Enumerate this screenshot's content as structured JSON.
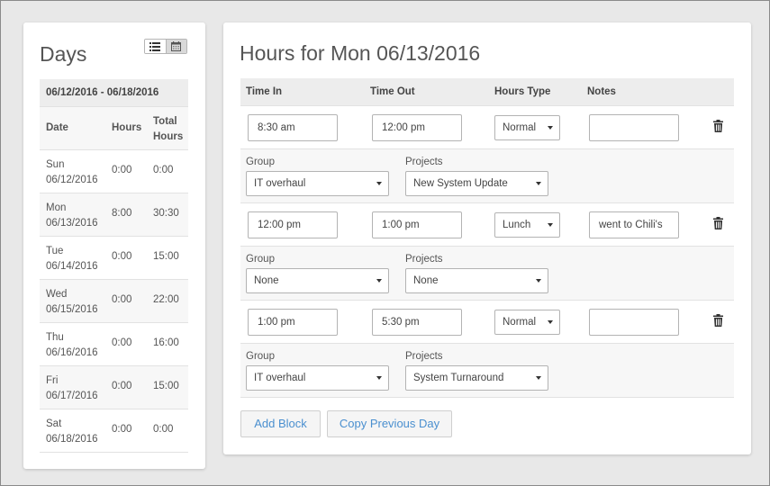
{
  "days_panel": {
    "title": "Days",
    "week_range": "06/12/2016 - 06/18/2016",
    "columns": {
      "date": "Date",
      "hours": "Hours",
      "total_line1": "Total",
      "total_line2": "Hours"
    },
    "days": [
      {
        "dow": "Sun",
        "date": "06/12/2016",
        "hours": "0:00",
        "total": "0:00"
      },
      {
        "dow": "Mon",
        "date": "06/13/2016",
        "hours": "8:00",
        "total": "30:30"
      },
      {
        "dow": "Tue",
        "date": "06/14/2016",
        "hours": "0:00",
        "total": "15:00"
      },
      {
        "dow": "Wed",
        "date": "06/15/2016",
        "hours": "0:00",
        "total": "22:00"
      },
      {
        "dow": "Thu",
        "date": "06/16/2016",
        "hours": "0:00",
        "total": "16:00"
      },
      {
        "dow": "Fri",
        "date": "06/17/2016",
        "hours": "0:00",
        "total": "15:00"
      },
      {
        "dow": "Sat",
        "date": "06/18/2016",
        "hours": "0:00",
        "total": "0:00"
      }
    ],
    "view_toggle": {
      "list_icon": "list-icon",
      "calendar_icon": "calendar-icon"
    }
  },
  "hours_panel": {
    "title": "Hours for Mon 06/13/2016",
    "columns": {
      "time_in": "Time In",
      "time_out": "Time Out",
      "hours_type": "Hours Type",
      "notes": "Notes"
    },
    "group_label": "Group",
    "projects_label": "Projects",
    "blocks": [
      {
        "time_in": "8:30 am",
        "time_out": "12:00 pm",
        "hours_type": "Normal",
        "notes": "",
        "group": "IT overhaul",
        "project": "New System Update"
      },
      {
        "time_in": "12:00 pm",
        "time_out": "1:00 pm",
        "hours_type": "Lunch",
        "notes": "went to Chili's",
        "group": "None",
        "project": "None"
      },
      {
        "time_in": "1:00 pm",
        "time_out": "5:30 pm",
        "hours_type": "Normal",
        "notes": "",
        "group": "IT overhaul",
        "project": "System Turnaround"
      }
    ],
    "buttons": {
      "add_block": "Add Block",
      "copy_previous_day": "Copy Previous Day"
    }
  },
  "colors": {
    "background": "#e8e8e8",
    "card": "#ffffff",
    "header_row": "#ededed",
    "link_blue": "#4a8fcf"
  }
}
